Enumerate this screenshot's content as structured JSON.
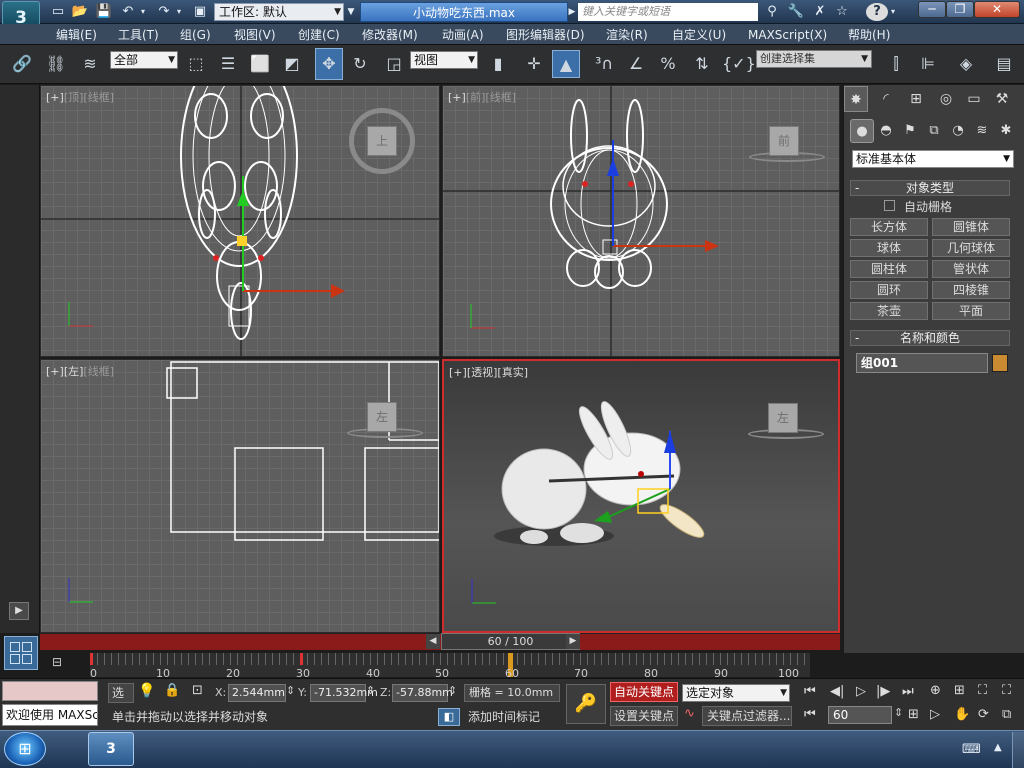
{
  "app": {
    "logo_text": "3",
    "workspace_label": "工作区: 默认",
    "document_title": "小动物吃东西.max",
    "search_placeholder": "键入关键字或短语"
  },
  "menu": [
    "编辑(E)",
    "工具(T)",
    "组(G)",
    "视图(V)",
    "创建(C)",
    "修改器(M)",
    "动画(A)",
    "图形编辑器(D)",
    "渲染(R)",
    "自定义(U)",
    "MAXScript(X)",
    "帮助(H)"
  ],
  "toolbar": {
    "selection_filter": "全部",
    "reference_coord": "视图",
    "named_selection_placeholder": "创建选择集"
  },
  "viewports": [
    {
      "name": "top",
      "label_a": "[+]",
      "label_b": "[顶]",
      "label_c": "[线框]",
      "cube": "上"
    },
    {
      "name": "front",
      "label_a": "[+]",
      "label_b": "[前]",
      "label_c": "[线框]",
      "cube": "前"
    },
    {
      "name": "left",
      "label_a": "[+]",
      "label_b": "[左]",
      "label_c": "[线框]",
      "cube": "左"
    },
    {
      "name": "perspective",
      "label_a": "[+]",
      "label_b": "[透视]",
      "label_c": "[真实]",
      "cube": "左"
    }
  ],
  "command_panel": {
    "category": "标准基本体",
    "object_type_header": "对象类型",
    "autogrid_label": "自动栅格",
    "primitives": [
      "长方体",
      "圆锥体",
      "球体",
      "几何球体",
      "圆柱体",
      "管状体",
      "圆环",
      "四棱锥",
      "茶壶",
      "平面"
    ],
    "name_color_header": "名称和颜色",
    "object_name": "组001",
    "object_color": "#c98a31"
  },
  "timeline": {
    "frame_display": "60 / 100",
    "current_frame": 60,
    "total_frames": 100,
    "ticks": [
      "0",
      "10",
      "20",
      "30",
      "40",
      "50",
      "60",
      "70",
      "80",
      "90",
      "100"
    ]
  },
  "status": {
    "script_listener": "欢迎使用 MAXSc",
    "selection_label": "选择",
    "x_label": "X:",
    "x_value": "2.544mm",
    "y_label": "Y:",
    "y_value": "-71.532mm",
    "z_label": "Z:",
    "z_value": "-57.88mm",
    "grid_label": "栅格 = 10.0mm",
    "prompt": "单击并拖动以选择并移动对象",
    "add_time_tag": "添加时间标记",
    "auto_key": "自动关键点",
    "set_key": "设置关键点",
    "key_mode": "选定对象",
    "key_filters": "关键点过滤器...",
    "frame_field": "60"
  }
}
